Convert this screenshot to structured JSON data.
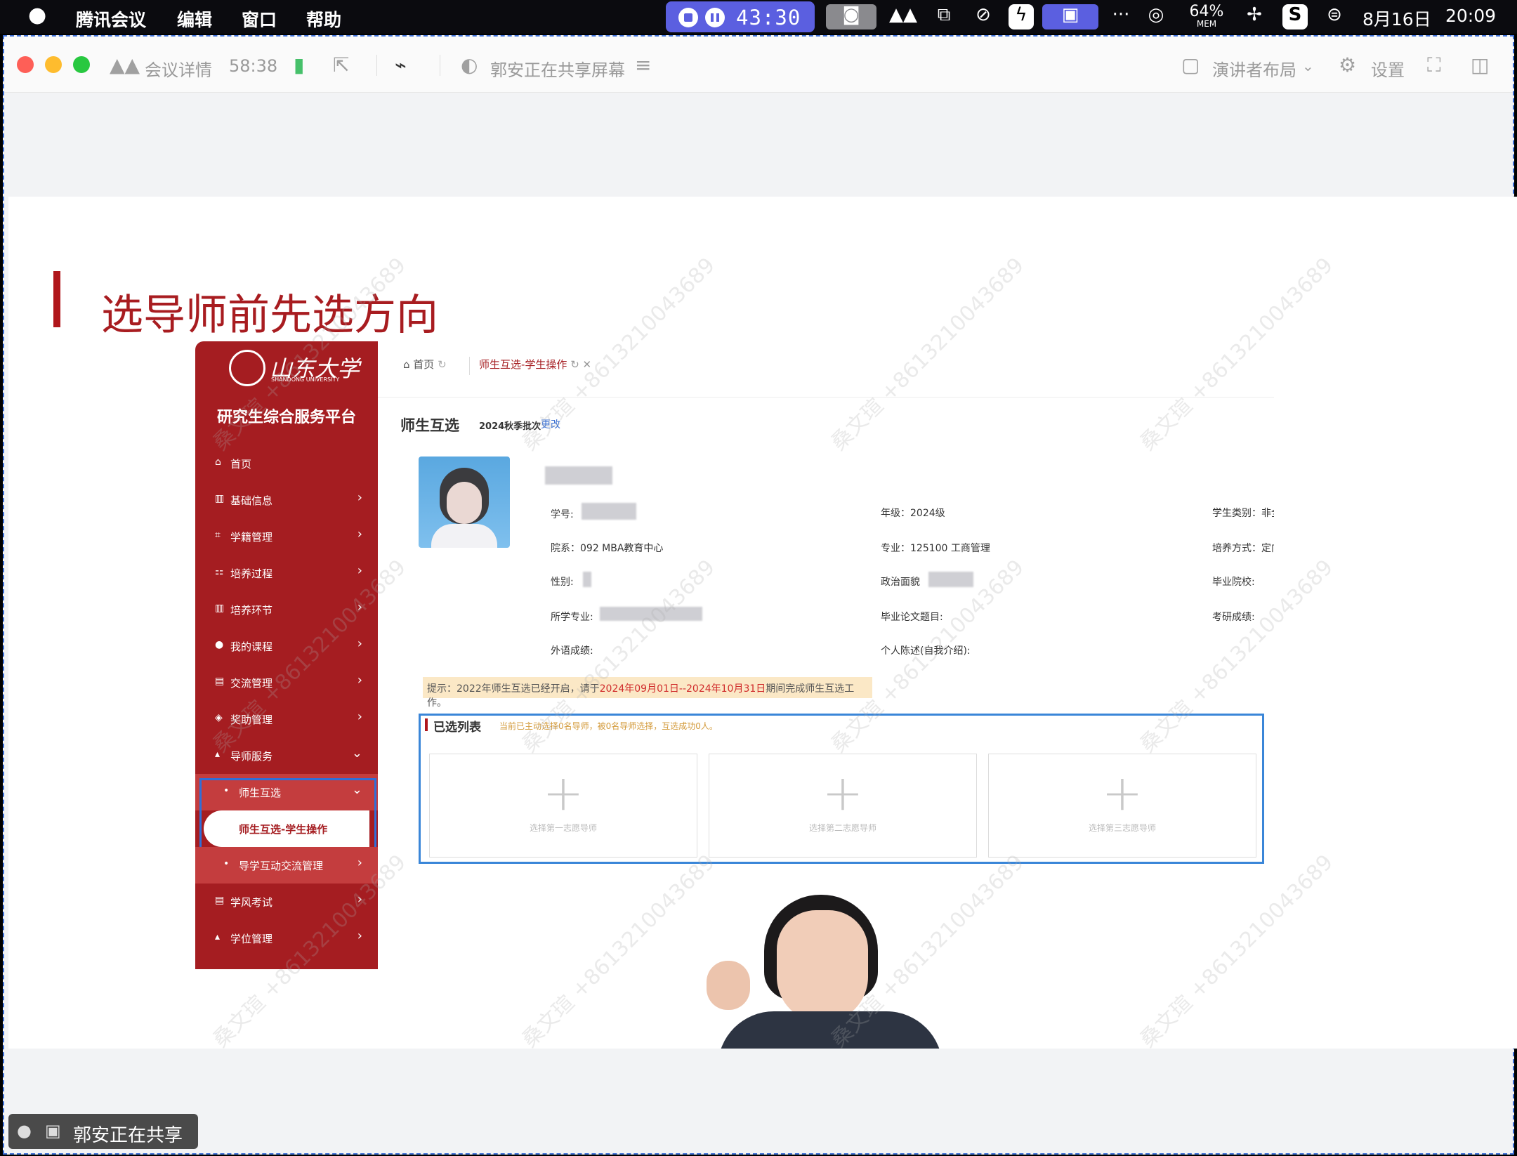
{
  "menubar": {
    "app_name": "腾讯会议",
    "menus": [
      "编辑",
      "窗口",
      "帮助"
    ],
    "recording_time": "43:30",
    "mem_percent": "64%",
    "mem_label": "MEM",
    "date": "8月16日",
    "time": "20:09"
  },
  "toolbar": {
    "meeting_details": "会议详情",
    "duration": "58:38",
    "sharer_status": "郭安正在共享屏幕",
    "layout_label": "演讲者布局",
    "settings_label": "设置"
  },
  "slide": {
    "title": "选导师前先选方向",
    "watermark": "桑文瑄 +8613210043689"
  },
  "portal": {
    "logo_text": "山东大学",
    "logo_en": "SHANDONG UNIVERSITY",
    "platform_name": "研究生综合服务平台",
    "nav": [
      {
        "label": "首页",
        "icon": "home-icon"
      },
      {
        "label": "基础信息",
        "icon": "chart-icon"
      },
      {
        "label": "学籍管理",
        "icon": "scan-icon"
      },
      {
        "label": "培养过程",
        "icon": "org-icon"
      },
      {
        "label": "培养环节",
        "icon": "chart-icon"
      },
      {
        "label": "我的课程",
        "icon": "user-icon"
      },
      {
        "label": "交流管理",
        "icon": "doc-icon"
      },
      {
        "label": "奖助管理",
        "icon": "shield-icon"
      },
      {
        "label": "导师服务",
        "icon": "cap-icon"
      },
      {
        "label": "师生互选",
        "icon": "dot-icon"
      },
      {
        "label": "师生互选-学生操作",
        "icon": ""
      },
      {
        "label": "导学互动交流管理",
        "icon": "dot-icon"
      },
      {
        "label": "学风考试",
        "icon": "doc-icon"
      },
      {
        "label": "学位管理",
        "icon": "cap-icon"
      }
    ],
    "tabs": {
      "home": "首页",
      "current": "师生互选-学生操作"
    },
    "section_title": "师生互选",
    "batch": "2024秋季批次",
    "change_link": "更改",
    "info": {
      "student_id_label": "学号:",
      "grade": "年级：2024级",
      "student_type": "学生类别：非全",
      "department": "院系：092 MBA教育中心",
      "major": "专业：125100 工商管理",
      "training_mode": "培养方式：定向",
      "gender_label": "性别:",
      "political_label": "政治面貌",
      "graduate_school_label": "毕业院校:",
      "studied_major_label": "所学专业:",
      "thesis_label": "毕业论文题目:",
      "exam_score_label": "考研成绩:",
      "foreign_lang_label": "外语成绩:",
      "self_intro_label": "个人陈述(自我介绍):"
    },
    "tip": {
      "prefix": "提示：2022年师生互选已经开启，请于",
      "period": "2024年09月01日--2024年10月31日",
      "suffix": "期间完成师生互选工作。"
    },
    "selected": {
      "title": "已选列表",
      "note": "当前已主动选择0名导师，被0名导师选择，互选成功0人。",
      "choices": [
        "选择第一志愿导师",
        "选择第二志愿导师",
        "选择第三志愿导师"
      ]
    }
  },
  "share_badge": "郭安正在共享"
}
